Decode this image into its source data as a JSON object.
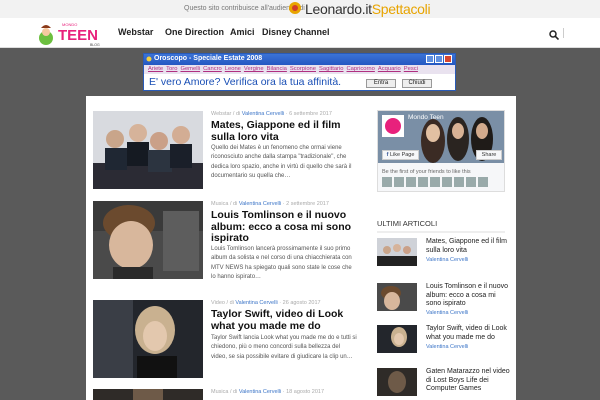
{
  "topbar": {
    "note": "Questo sito contribuisce all'audience di",
    "partner_main": "Leonardo.it",
    "partner_sub": "Spettacoli"
  },
  "logo": {
    "top": "MONDO",
    "main": "TEEN",
    "sub": "BLOG"
  },
  "nav": {
    "items": [
      {
        "label": "Webstar"
      },
      {
        "label": "One Direction"
      },
      {
        "label": "Amici"
      },
      {
        "label": "Disney Channel"
      }
    ]
  },
  "ad": {
    "title": "Oroscopo - Speciale Estate 2008",
    "signs": [
      "Ariete",
      "Toro",
      "Gemelli",
      "Cancro",
      "Leone",
      "Vergine",
      "Bilancia",
      "Scorpione",
      "Sagittario",
      "Capricorno",
      "Acquario",
      "Pesci"
    ],
    "headline": "E' vero Amore? Verifica ora la tua affinità.",
    "btn1": "Entra",
    "btn2": "Chiudi"
  },
  "articles": [
    {
      "category": "Webstar",
      "by": "di",
      "author": "Valentina Cervelli",
      "date": "6 settembre 2017",
      "title": "Mates, Giappone ed il film sulla loro vita",
      "excerpt": "Quello dei Mates è un fenomeno che ormai viene riconosciuto anche dalla stampa \"tradizionale\", che dedica loro spazio, anche in virtù di quello che sarà il documentario su quella che…"
    },
    {
      "category": "Musica",
      "by": "di",
      "author": "Valentina Cervelli",
      "date": "2 settembre 2017",
      "title": "Louis Tomlinson e il nuovo album: ecco a cosa mi sono ispirato",
      "excerpt": "Louis Tomlinson lancerà prossimamente il suo primo album da solista e nel corso di una chiacchierata con MTV NEWS ha spiegato quali sono state le cose che lo hanno ispirato…"
    },
    {
      "category": "Video",
      "by": "di",
      "author": "Valentina Cervelli",
      "date": "26 agosto 2017",
      "title": "Taylor Swift, video di Look what you made me do",
      "excerpt": "Taylor Swift lancia Look what you made me do e tutti si chiedono, più o meno concordi sulla bellezza del video, se sia possibile evitare di giudicare la clip un…"
    },
    {
      "category": "Musica",
      "by": "di",
      "author": "Valentina Cervelli",
      "date": "18 agosto 2017",
      "title": "",
      "excerpt": ""
    }
  ],
  "sidebar": {
    "fb": {
      "page_name": "Mondo Teen",
      "like": "Like Page",
      "share": "Share",
      "friends": "Be the first of your friends to like this"
    },
    "heading": "ULTIMI ARTICOLI",
    "items": [
      {
        "title": "Mates, Giappone ed il film sulla loro vita",
        "author": "Valentina Cervelli"
      },
      {
        "title": "Louis Tomlinson e il nuovo album: ecco a cosa mi sono ispirato",
        "author": "Valentina Cervelli"
      },
      {
        "title": "Taylor Swift, video di Look what you made me do",
        "author": "Valentina Cervelli"
      },
      {
        "title": "Gaten Matarazzo nel video di Lost Boys Life dei Computer Games",
        "author": "Valentina Cervelli"
      }
    ]
  },
  "colors": {
    "accent_link": "#3b74c7",
    "ad_frame": "#2a5bb7",
    "page_bg": "#5a5a5a",
    "logo_pink": "#e8217c"
  }
}
